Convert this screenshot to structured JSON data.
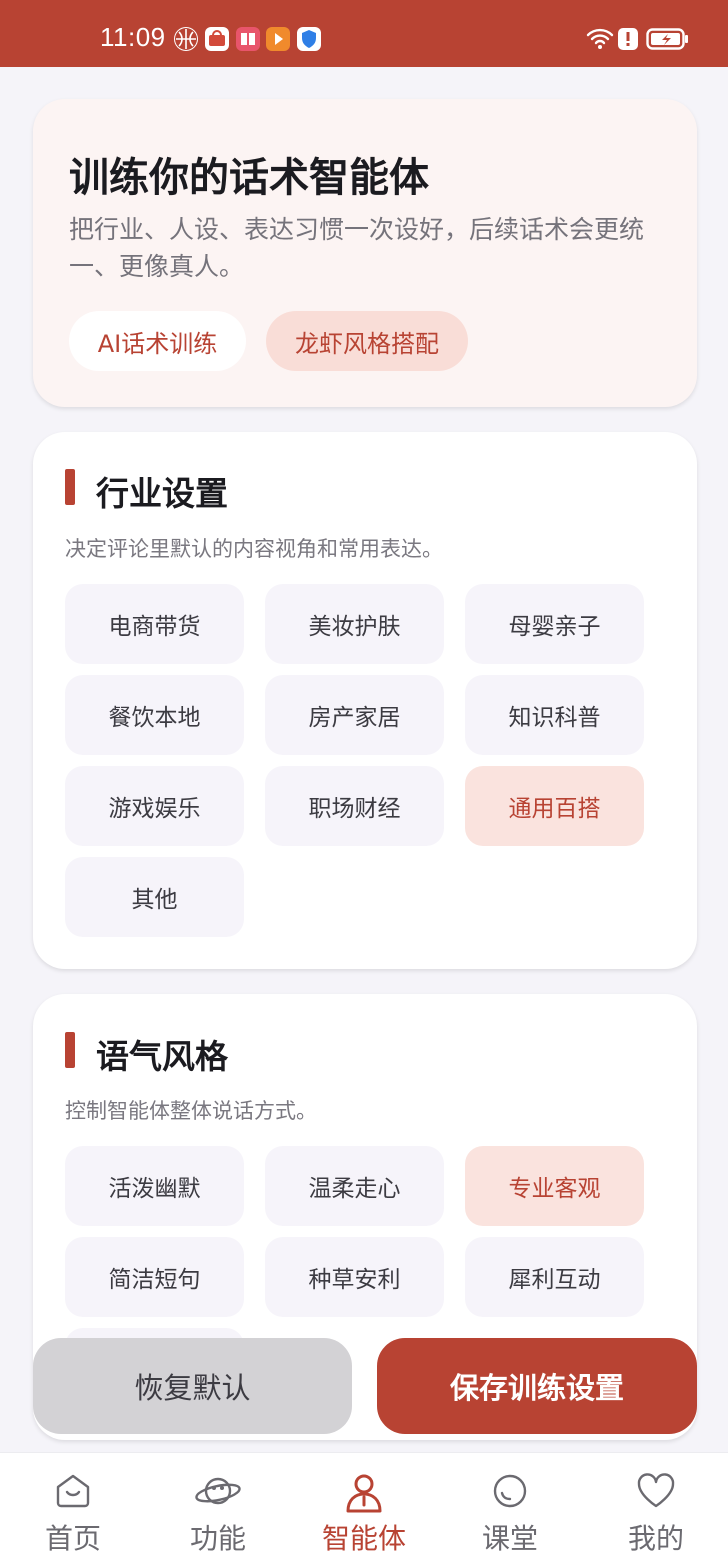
{
  "status_bar": {
    "time": "11:09"
  },
  "hero": {
    "title": "训练你的话术智能体",
    "subtitle": "把行业、人设、表达习惯一次设好，后续话术会更统一、更像真人。",
    "tab_ai": "AI话术训练",
    "tab_style": "龙虾风格搭配"
  },
  "industry": {
    "title": "行业设置",
    "desc": "决定评论里默认的内容视角和常用表达。",
    "options": [
      "电商带货",
      "美妆护肤",
      "母婴亲子",
      "餐饮本地",
      "房产家居",
      "知识科普",
      "游戏娱乐",
      "职场财经",
      "通用百搭",
      "其他"
    ],
    "selected": "通用百搭"
  },
  "tone": {
    "title": "语气风格",
    "desc": "控制智能体整体说话方式。",
    "options": [
      "活泼幽默",
      "温柔走心",
      "专业客观",
      "简洁短句",
      "种草安利",
      "犀利互动"
    ],
    "selected": "专业客观"
  },
  "actions": {
    "reset": "恢复默认",
    "save": "保存训练设置"
  },
  "nav": {
    "items": [
      {
        "label": "首页",
        "icon": "home-icon"
      },
      {
        "label": "功能",
        "icon": "planet-icon"
      },
      {
        "label": "智能体",
        "icon": "agent-icon"
      },
      {
        "label": "课堂",
        "icon": "classroom-icon"
      },
      {
        "label": "我的",
        "icon": "heart-icon"
      }
    ],
    "active": "智能体"
  },
  "colors": {
    "accent": "#b84333",
    "selected_bg": "#fae3de",
    "chip_bg": "#f6f4fa",
    "page_bg": "#f5f4f9"
  }
}
